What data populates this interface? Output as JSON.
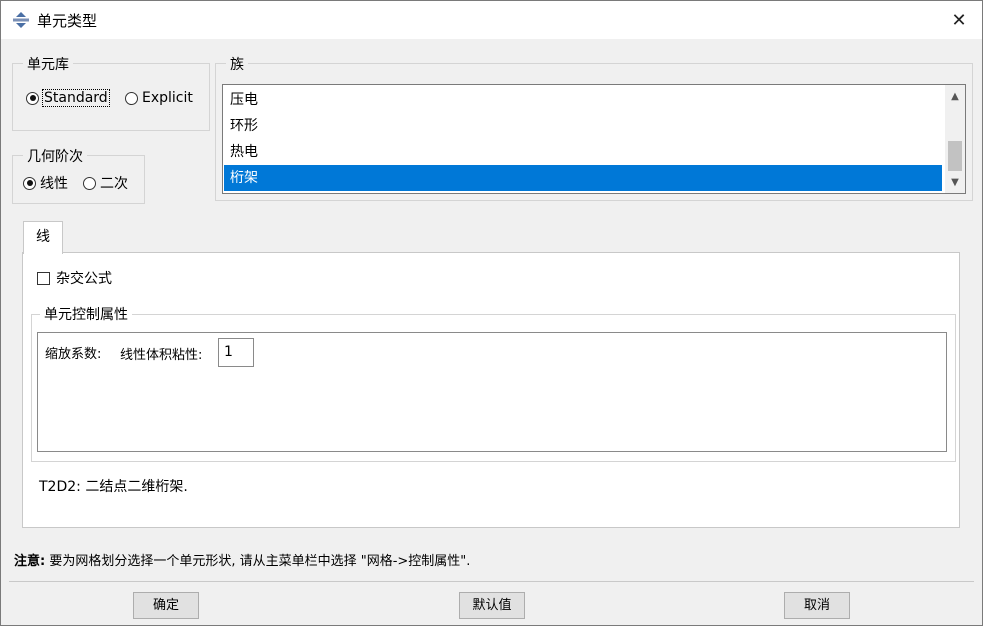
{
  "window": {
    "title": "单元类型"
  },
  "element_library": {
    "legend": "单元库",
    "options": [
      {
        "label": "Standard",
        "selected": true
      },
      {
        "label": "Explicit",
        "selected": false
      }
    ]
  },
  "geometric_order": {
    "legend": "几何阶次",
    "options": [
      {
        "label": "线性",
        "selected": true
      },
      {
        "label": "二次",
        "selected": false
      }
    ]
  },
  "family": {
    "legend": "族",
    "items": [
      "压电",
      "环形",
      "热电",
      "桁架"
    ],
    "selected": "桁架"
  },
  "tabs": [
    {
      "label": "线",
      "active": true
    }
  ],
  "hybrid_formulation": {
    "label": "杂交公式",
    "checked": false
  },
  "element_controls": {
    "legend": "单元控制属性",
    "scale_factors_label": "缩放系数:",
    "linear_bulk_viscosity_label": "线性体积粘性:",
    "linear_bulk_viscosity_value": "1"
  },
  "description": "T2D2:  二结点二维桁架.",
  "note": {
    "prefix": "注意:",
    "text": "要为网格划分选择一个单元形状, 请从主菜单栏中选择 \"网格->控制属性\"."
  },
  "buttons": {
    "ok": "确定",
    "defaults": "默认值",
    "cancel": "取消"
  },
  "colors": {
    "selection": "#0078d7",
    "dialog_bg": "#f0f0f0"
  }
}
